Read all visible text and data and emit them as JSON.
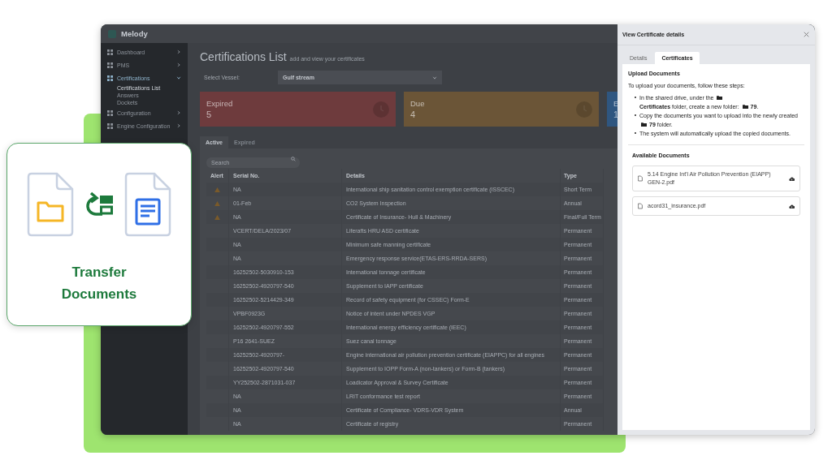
{
  "app": {
    "name": "Melody"
  },
  "sidebar": {
    "items": [
      {
        "label": "Dashboard",
        "selected": false,
        "expanded": false
      },
      {
        "label": "PMS",
        "selected": false,
        "expanded": false
      },
      {
        "label": "Certifications",
        "selected": true,
        "expanded": true,
        "children": [
          {
            "label": "Certifications List",
            "selected": true
          },
          {
            "label": "Answers",
            "selected": false
          },
          {
            "label": "Dockets",
            "selected": false
          }
        ]
      },
      {
        "label": "Configuration",
        "selected": false,
        "expanded": false
      },
      {
        "label": "Engine Configuration",
        "selected": false,
        "expanded": false
      }
    ]
  },
  "page": {
    "title": "Certifications List",
    "subtitle": "add and view your certificates"
  },
  "vessel_select": {
    "label": "Select Vessel:",
    "value": "Gulf stream"
  },
  "stats": [
    {
      "label": "Expired",
      "count": "5",
      "color": "#6e3b3d"
    },
    {
      "label": "Due",
      "count": "4",
      "color": "#6b5537"
    },
    {
      "label": "E",
      "count": "1",
      "color": "#2f5680"
    }
  ],
  "list_tabs": [
    {
      "label": "Active",
      "selected": true
    },
    {
      "label": "Expired",
      "selected": false
    }
  ],
  "search": {
    "placeholder": "Search"
  },
  "table": {
    "columns": [
      "Alert",
      "Serial No.",
      "Details",
      "Type"
    ],
    "rows": [
      {
        "alert": true,
        "serial": "NA",
        "details": "International ship sanitation control exemption certificate (ISSCEC)",
        "type": "Short Term"
      },
      {
        "alert": true,
        "serial": "01-Feb",
        "details": "CO2 System Inspection",
        "type": "Annual"
      },
      {
        "alert": true,
        "serial": "NA",
        "details": "Certificate of Insurance- Hull & Machinery",
        "type": "Final/Full Term"
      },
      {
        "alert": false,
        "serial": "VCERT/DELA/2023/07",
        "details": "Liferafts HRU ASD certificate",
        "type": "Permanent"
      },
      {
        "alert": false,
        "serial": "NA",
        "details": "Minimum safe manning certificate",
        "type": "Permanent"
      },
      {
        "alert": false,
        "serial": "NA",
        "details": "Emergency response service(ETAS-ERS-RRDA-SERS)",
        "type": "Permanent"
      },
      {
        "alert": false,
        "serial": "16252502-5030910-153",
        "details": "International tonnage certificate",
        "type": "Permanent"
      },
      {
        "alert": false,
        "serial": "16252502-4920797-540",
        "details": "Supplement to IAPP certificate",
        "type": "Permanent"
      },
      {
        "alert": false,
        "serial": "16252502-5214429-349",
        "details": "Record of safety equipment (for CSSEC) Form-E",
        "type": "Permanent"
      },
      {
        "alert": false,
        "serial": "VPBF0923G",
        "details": "Notice of intent under NPDES VGP",
        "type": "Permanent"
      },
      {
        "alert": false,
        "serial": "16252502-4920797-552",
        "details": "International energy efficiency certificate (IEEC)",
        "type": "Permanent"
      },
      {
        "alert": false,
        "serial": "P16 2641-SUEZ",
        "details": "Suez canal tonnage",
        "type": "Permanent"
      },
      {
        "alert": false,
        "serial": "16252502-4920797-",
        "details": "Engine international air pollution prevention certificate (EIAPPC) for all engines",
        "type": "Permanent"
      },
      {
        "alert": false,
        "serial": "16252502-4920797-540",
        "details": "Supplement to IOPP Form-A (non-tankers) or Form-B (tankers)",
        "type": "Permanent"
      },
      {
        "alert": false,
        "serial": "YY252502-2871031-037",
        "details": "Loadicator Approval & Survey Certificate",
        "type": "Permanent"
      },
      {
        "alert": false,
        "serial": "NA",
        "details": "LRIT conformance test report",
        "type": "Permanent"
      },
      {
        "alert": false,
        "serial": "NA",
        "details": "Certificate of Compliance- VDRS-VDR System",
        "type": "Annual"
      },
      {
        "alert": false,
        "serial": "NA",
        "details": "Certificate of registry",
        "type": "Permanent"
      }
    ]
  },
  "drawer": {
    "title": "View Certificate details",
    "tabs": [
      {
        "label": "Details",
        "selected": false
      },
      {
        "label": "Certificates",
        "selected": true
      }
    ],
    "upload_heading": "Upload Documents",
    "intro": "To upload your documents, follow these steps:",
    "steps": [
      [
        {
          "kind": "text",
          "text": "In the shared drive, under the"
        },
        {
          "kind": "folder"
        },
        {
          "kind": "text",
          "text": "**Certificates** folder, create a new folder:"
        },
        {
          "kind": "folder"
        },
        {
          "kind": "text",
          "text": "**79**."
        }
      ],
      [
        {
          "kind": "text",
          "text": "Copy the documents you want to upload into the newly created"
        },
        {
          "kind": "folder"
        },
        {
          "kind": "text",
          "text": "**79** folder."
        }
      ],
      [
        {
          "kind": "text",
          "text": "The system will automatically upload the copied documents."
        }
      ]
    ],
    "documents_heading": "Available Documents",
    "documents": [
      {
        "name": "5.14 Engine Int'l Air Pollution Prevention (EIAPP) GEN-2.pdf"
      },
      {
        "name": "acord31_insurance.pdf"
      }
    ]
  },
  "feature_card": {
    "title": "Transfer Documents"
  }
}
